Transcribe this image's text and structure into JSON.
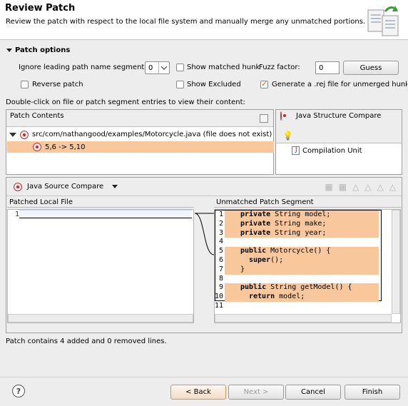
{
  "banner": {
    "title": "Review Patch",
    "description": "Review the patch with respect to the local file system and manually merge any unmatched portions."
  },
  "patch_options": {
    "section_label": "Patch options",
    "ignore_label": "Ignore leading path name segments:",
    "ignore_value": "0",
    "show_matched_hunk_label": "Show matched hunk",
    "show_matched_hunk_checked": false,
    "fuzz_label": "Fuzz factor:",
    "fuzz_value": "0",
    "guess_label": "Guess",
    "reverse_patch_label": "Reverse patch",
    "reverse_patch_checked": false,
    "show_excluded_label": "Show Excluded",
    "show_excluded_checked": false,
    "generate_rej_label": "Generate a .rej file for unmerged hunk",
    "generate_rej_checked": true
  },
  "instruction": "Double-click on file or patch segment entries to view their content:",
  "patch_contents": {
    "title": "Patch Contents",
    "file_entry": "src/com/nathangood/examples/Motorcycle.java (file does not exist)",
    "hunk_entry": "5,6 -> 5,10"
  },
  "structure": {
    "title": "Java Structure Compare",
    "item": "Compilation Unit"
  },
  "source_compare": {
    "title": "Java Source Compare",
    "left_header": "Patched Local File",
    "right_header": "Unmatched Patch Segment",
    "left_lines": [
      "1"
    ],
    "right_lines": [
      {
        "n": "1",
        "kw": "private",
        "rest": " String model;"
      },
      {
        "n": "2",
        "kw": "private",
        "rest": " String make;"
      },
      {
        "n": "3",
        "kw": "private",
        "rest": " String year;"
      },
      {
        "n": "4",
        "kw": "",
        "rest": ""
      },
      {
        "n": "5",
        "kw": "public",
        "rest": " Motorcycle() {"
      },
      {
        "n": "6",
        "kw": "super",
        "rest": "();"
      },
      {
        "n": "7",
        "kw": "",
        "rest": "}"
      },
      {
        "n": "8",
        "kw": "",
        "rest": ""
      },
      {
        "n": "9",
        "kw": "public",
        "rest": " String getModel() {"
      },
      {
        "n": "10",
        "kw": "return",
        "rest": " model;"
      },
      {
        "n": "11",
        "kw": "",
        "rest": ""
      }
    ]
  },
  "status": "Patch contains 4 added and 0 removed lines.",
  "buttons": {
    "back": "< Back",
    "next": "Next >",
    "cancel": "Cancel",
    "finish": "Finish"
  },
  "colors": {
    "highlight": "#f8c89c",
    "accent": "#d7662a"
  }
}
